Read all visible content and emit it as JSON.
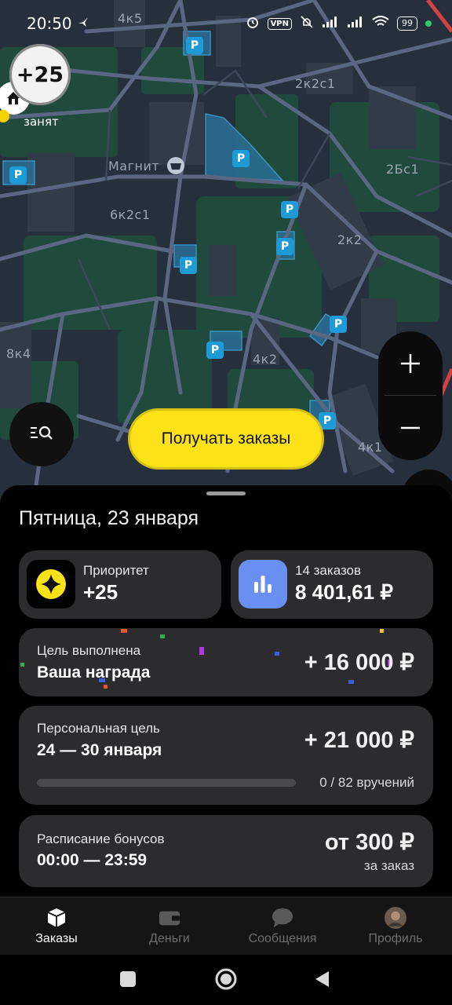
{
  "status_bar": {
    "time": "20:50",
    "network": "VPN",
    "battery": "99"
  },
  "map": {
    "labels": [
      "4к5",
      "2к2с1",
      "Магнит",
      "2Бс1",
      "6к2с1",
      "2к2",
      "8к4",
      "4к2",
      "4к1"
    ],
    "parking_symbol": "P",
    "priority_badge": "+25",
    "busy_label": "занят",
    "get_orders_button": "Получать заказы",
    "colors": {
      "background": "#25303c",
      "park": "#1f4a3c",
      "parking": "#1e9bd7",
      "accent_yellow": "#fde119"
    }
  },
  "sheet": {
    "date": "Пятница, 23 января",
    "priority": {
      "label": "Приоритет",
      "value": "+25",
      "icon": "priority-star-icon"
    },
    "orders": {
      "label": "14 заказов",
      "value": "8 401,61 ₽",
      "icon": "bar-chart-icon"
    },
    "goal": {
      "label": "Цель выполнена",
      "title": "Ваша награда",
      "amount": "+ 16 000 ₽"
    },
    "personal_goal": {
      "label": "Персональная цель",
      "dates": "24 — 30 января",
      "amount": "+ 21 000 ₽",
      "progress_text": "0 / 82 вручений",
      "progress": 0
    },
    "bonus_schedule": {
      "label": "Расписание бонусов",
      "hours": "00:00 — 23:59",
      "amount": "от 300 ₽",
      "note": "за заказ"
    }
  },
  "bottom_nav": {
    "items": [
      {
        "label": "Заказы",
        "icon": "box-icon",
        "active": true
      },
      {
        "label": "Деньги",
        "icon": "wallet-icon",
        "active": false
      },
      {
        "label": "Сообщения",
        "icon": "chat-icon",
        "active": false
      },
      {
        "label": "Профиль",
        "icon": "avatar-icon",
        "active": false
      }
    ]
  }
}
